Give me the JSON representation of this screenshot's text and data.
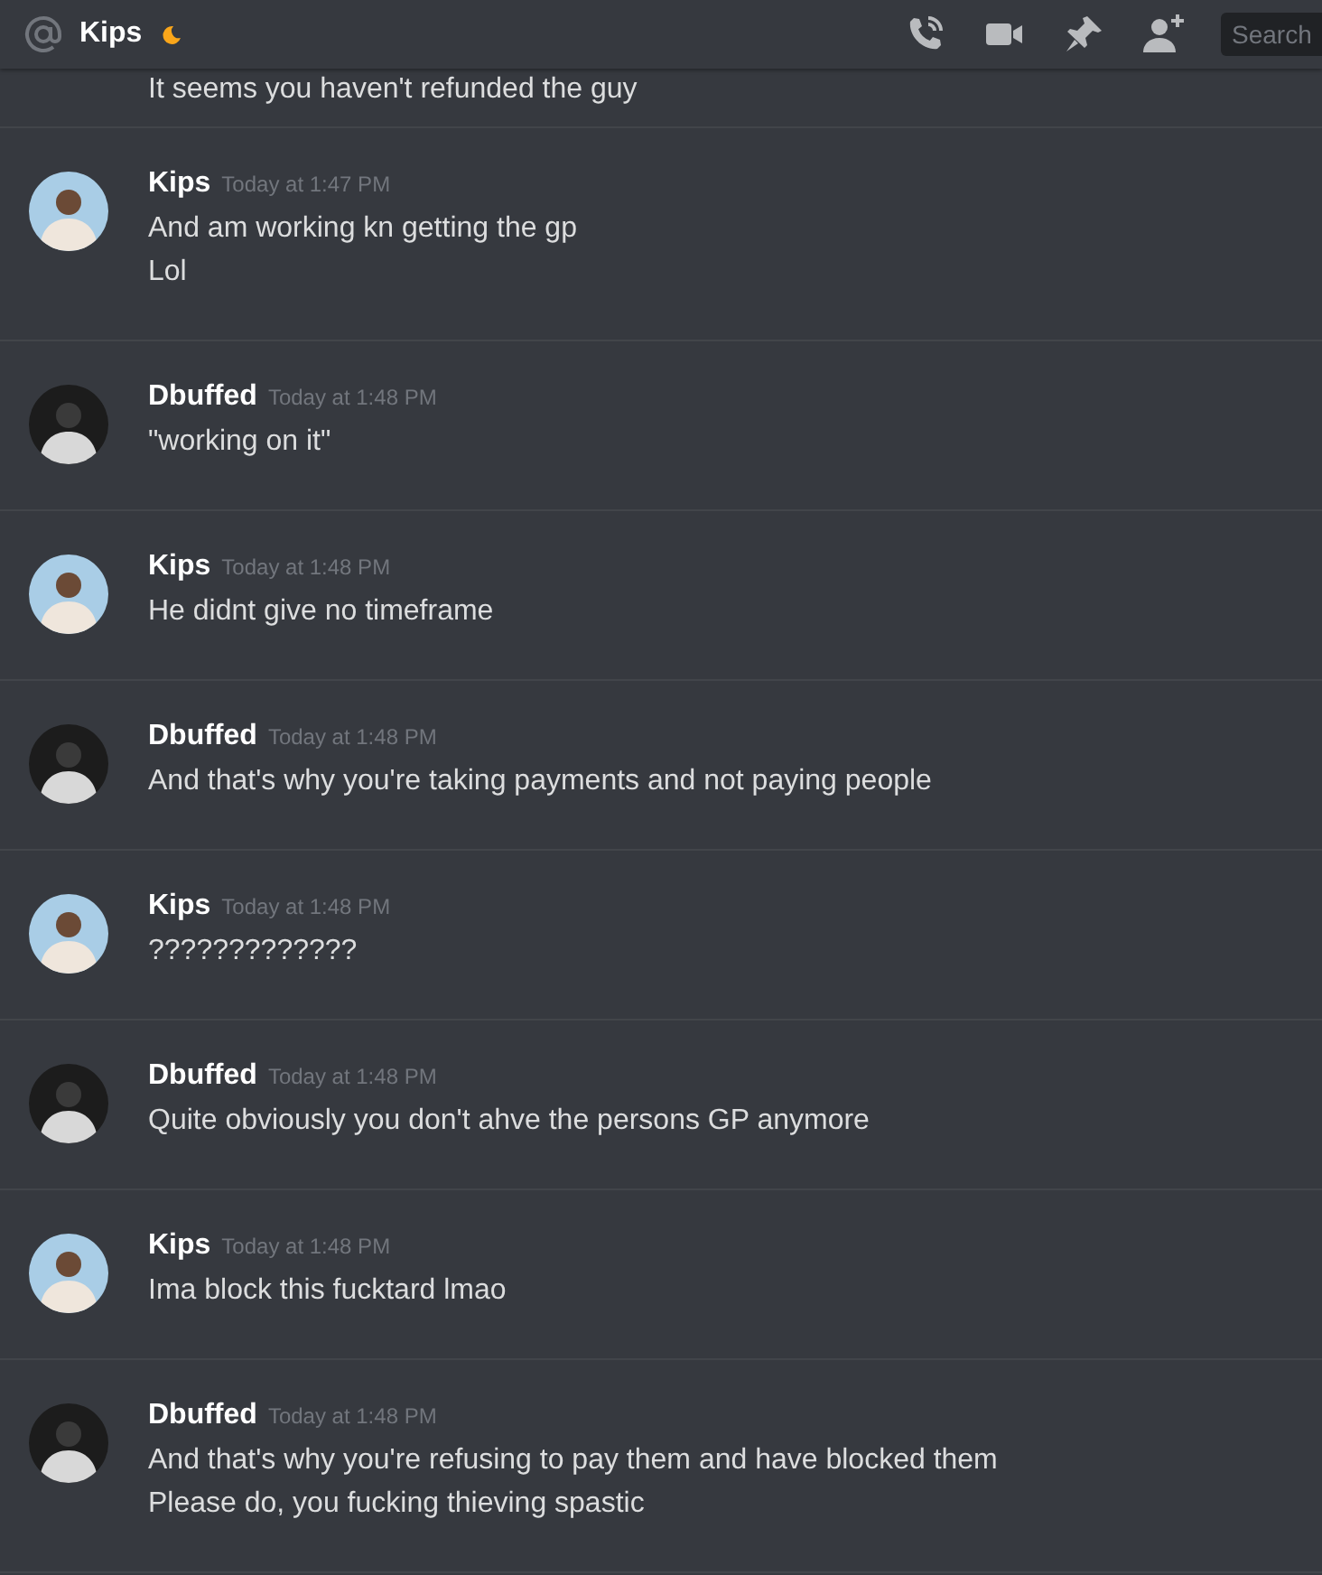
{
  "header": {
    "channel_name": "Kips",
    "search": {
      "placeholder": "Search"
    }
  },
  "messages": [
    {
      "lines": [
        "It seems you haven't refunded the guy"
      ]
    },
    {
      "author": "Kips",
      "time": "Today at 1:47 PM",
      "kind": "light",
      "lines": [
        "And am working kn getting the gp",
        "Lol"
      ]
    },
    {
      "author": "Dbuffed",
      "time": "Today at 1:48 PM",
      "kind": "dark",
      "lines": [
        "\"working on it\""
      ]
    },
    {
      "author": "Kips",
      "time": "Today at 1:48 PM",
      "kind": "light",
      "lines": [
        "He didnt give no timeframe"
      ]
    },
    {
      "author": "Dbuffed",
      "time": "Today at 1:48 PM",
      "kind": "dark",
      "lines": [
        "And that's why you're taking payments and not paying people"
      ]
    },
    {
      "author": "Kips",
      "time": "Today at 1:48 PM",
      "kind": "light",
      "lines": [
        "?????????????"
      ]
    },
    {
      "author": "Dbuffed",
      "time": "Today at 1:48 PM",
      "kind": "dark",
      "lines": [
        "Quite obviously you don't ahve the persons GP anymore"
      ]
    },
    {
      "author": "Kips",
      "time": "Today at 1:48 PM",
      "kind": "light",
      "lines": [
        "Ima block this fucktard lmao"
      ]
    },
    {
      "author": "Dbuffed",
      "time": "Today at 1:48 PM",
      "kind": "dark",
      "lines": [
        "And that's why you're refusing to pay them and have blocked them",
        "Please do, you fucking thieving spastic"
      ]
    }
  ]
}
